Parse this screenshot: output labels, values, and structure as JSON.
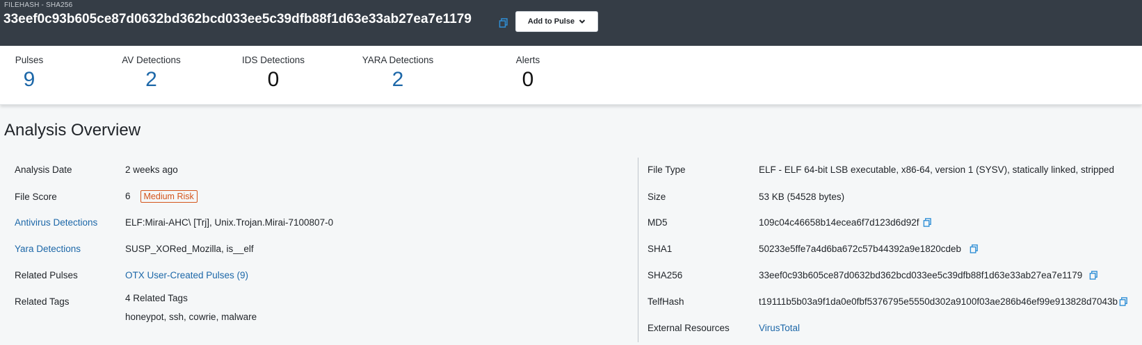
{
  "header": {
    "hash_type": "FILEHASH - SHA256",
    "hash": "33eef0c93b605ce87d0632bd362bcd033ee5c39dfb88f1d63e33ab27ea7e1179",
    "add_to_pulse_label": "Add to Pulse"
  },
  "stats": [
    {
      "label": "Pulses",
      "value": "9"
    },
    {
      "label": "AV Detections",
      "value": "2"
    },
    {
      "label": "IDS Detections",
      "value": "0"
    },
    {
      "label": "YARA Detections",
      "value": "2"
    },
    {
      "label": "Alerts",
      "value": "0"
    }
  ],
  "overview": {
    "title": "Analysis Overview",
    "left": {
      "analysis_date": {
        "label": "Analysis Date",
        "value": "2 weeks ago"
      },
      "file_score": {
        "label": "File Score",
        "value": "6",
        "risk": "Medium Risk"
      },
      "antivirus": {
        "label": "Antivirus Detections",
        "value": "ELF:Mirai-AHC\\ [Trj],  Unix.Trojan.Mirai-7100807-0"
      },
      "yara": {
        "label": "Yara Detections",
        "value": "SUSP_XORed_Mozilla,  is__elf"
      },
      "related_pulses": {
        "label": "Related Pulses",
        "value": "OTX User-Created Pulses (9)"
      },
      "related_tags": {
        "label": "Related Tags",
        "count_text": "4 Related Tags",
        "tags": "honeypot,  ssh,  cowrie,  malware"
      }
    },
    "right": {
      "file_type": {
        "label": "File Type",
        "value": "ELF - ELF 64-bit LSB executable, x86-64, version 1 (SYSV), statically linked, stripped"
      },
      "size": {
        "label": "Size",
        "value": "53 KB (54528 bytes)"
      },
      "md5": {
        "label": "MD5",
        "value": "109c04c46658b14ecea6f7d123d6d92f"
      },
      "sha1": {
        "label": "SHA1",
        "value": "50233e5ffe7a4d6ba672c57b44392a9e1820cdeb"
      },
      "sha256": {
        "label": "SHA256",
        "value": "33eef0c93b605ce87d0632bd362bcd033ee5c39dfb88f1d63e33ab27ea7e1179"
      },
      "telfhash": {
        "label": "TelfHash",
        "value": "t19111b5b03a9f1da0e0fbf5376795e5550d302a9100f03ae286b46ef99e913828d7043b"
      },
      "external": {
        "label": "External Resources",
        "value": "VirusTotal"
      }
    }
  },
  "colors": {
    "header_bg": "#353d46",
    "link_blue": "#1c67a8",
    "risk_orange": "#d4541a"
  },
  "icons": [
    "copy-icon",
    "chevron-down-icon"
  ]
}
